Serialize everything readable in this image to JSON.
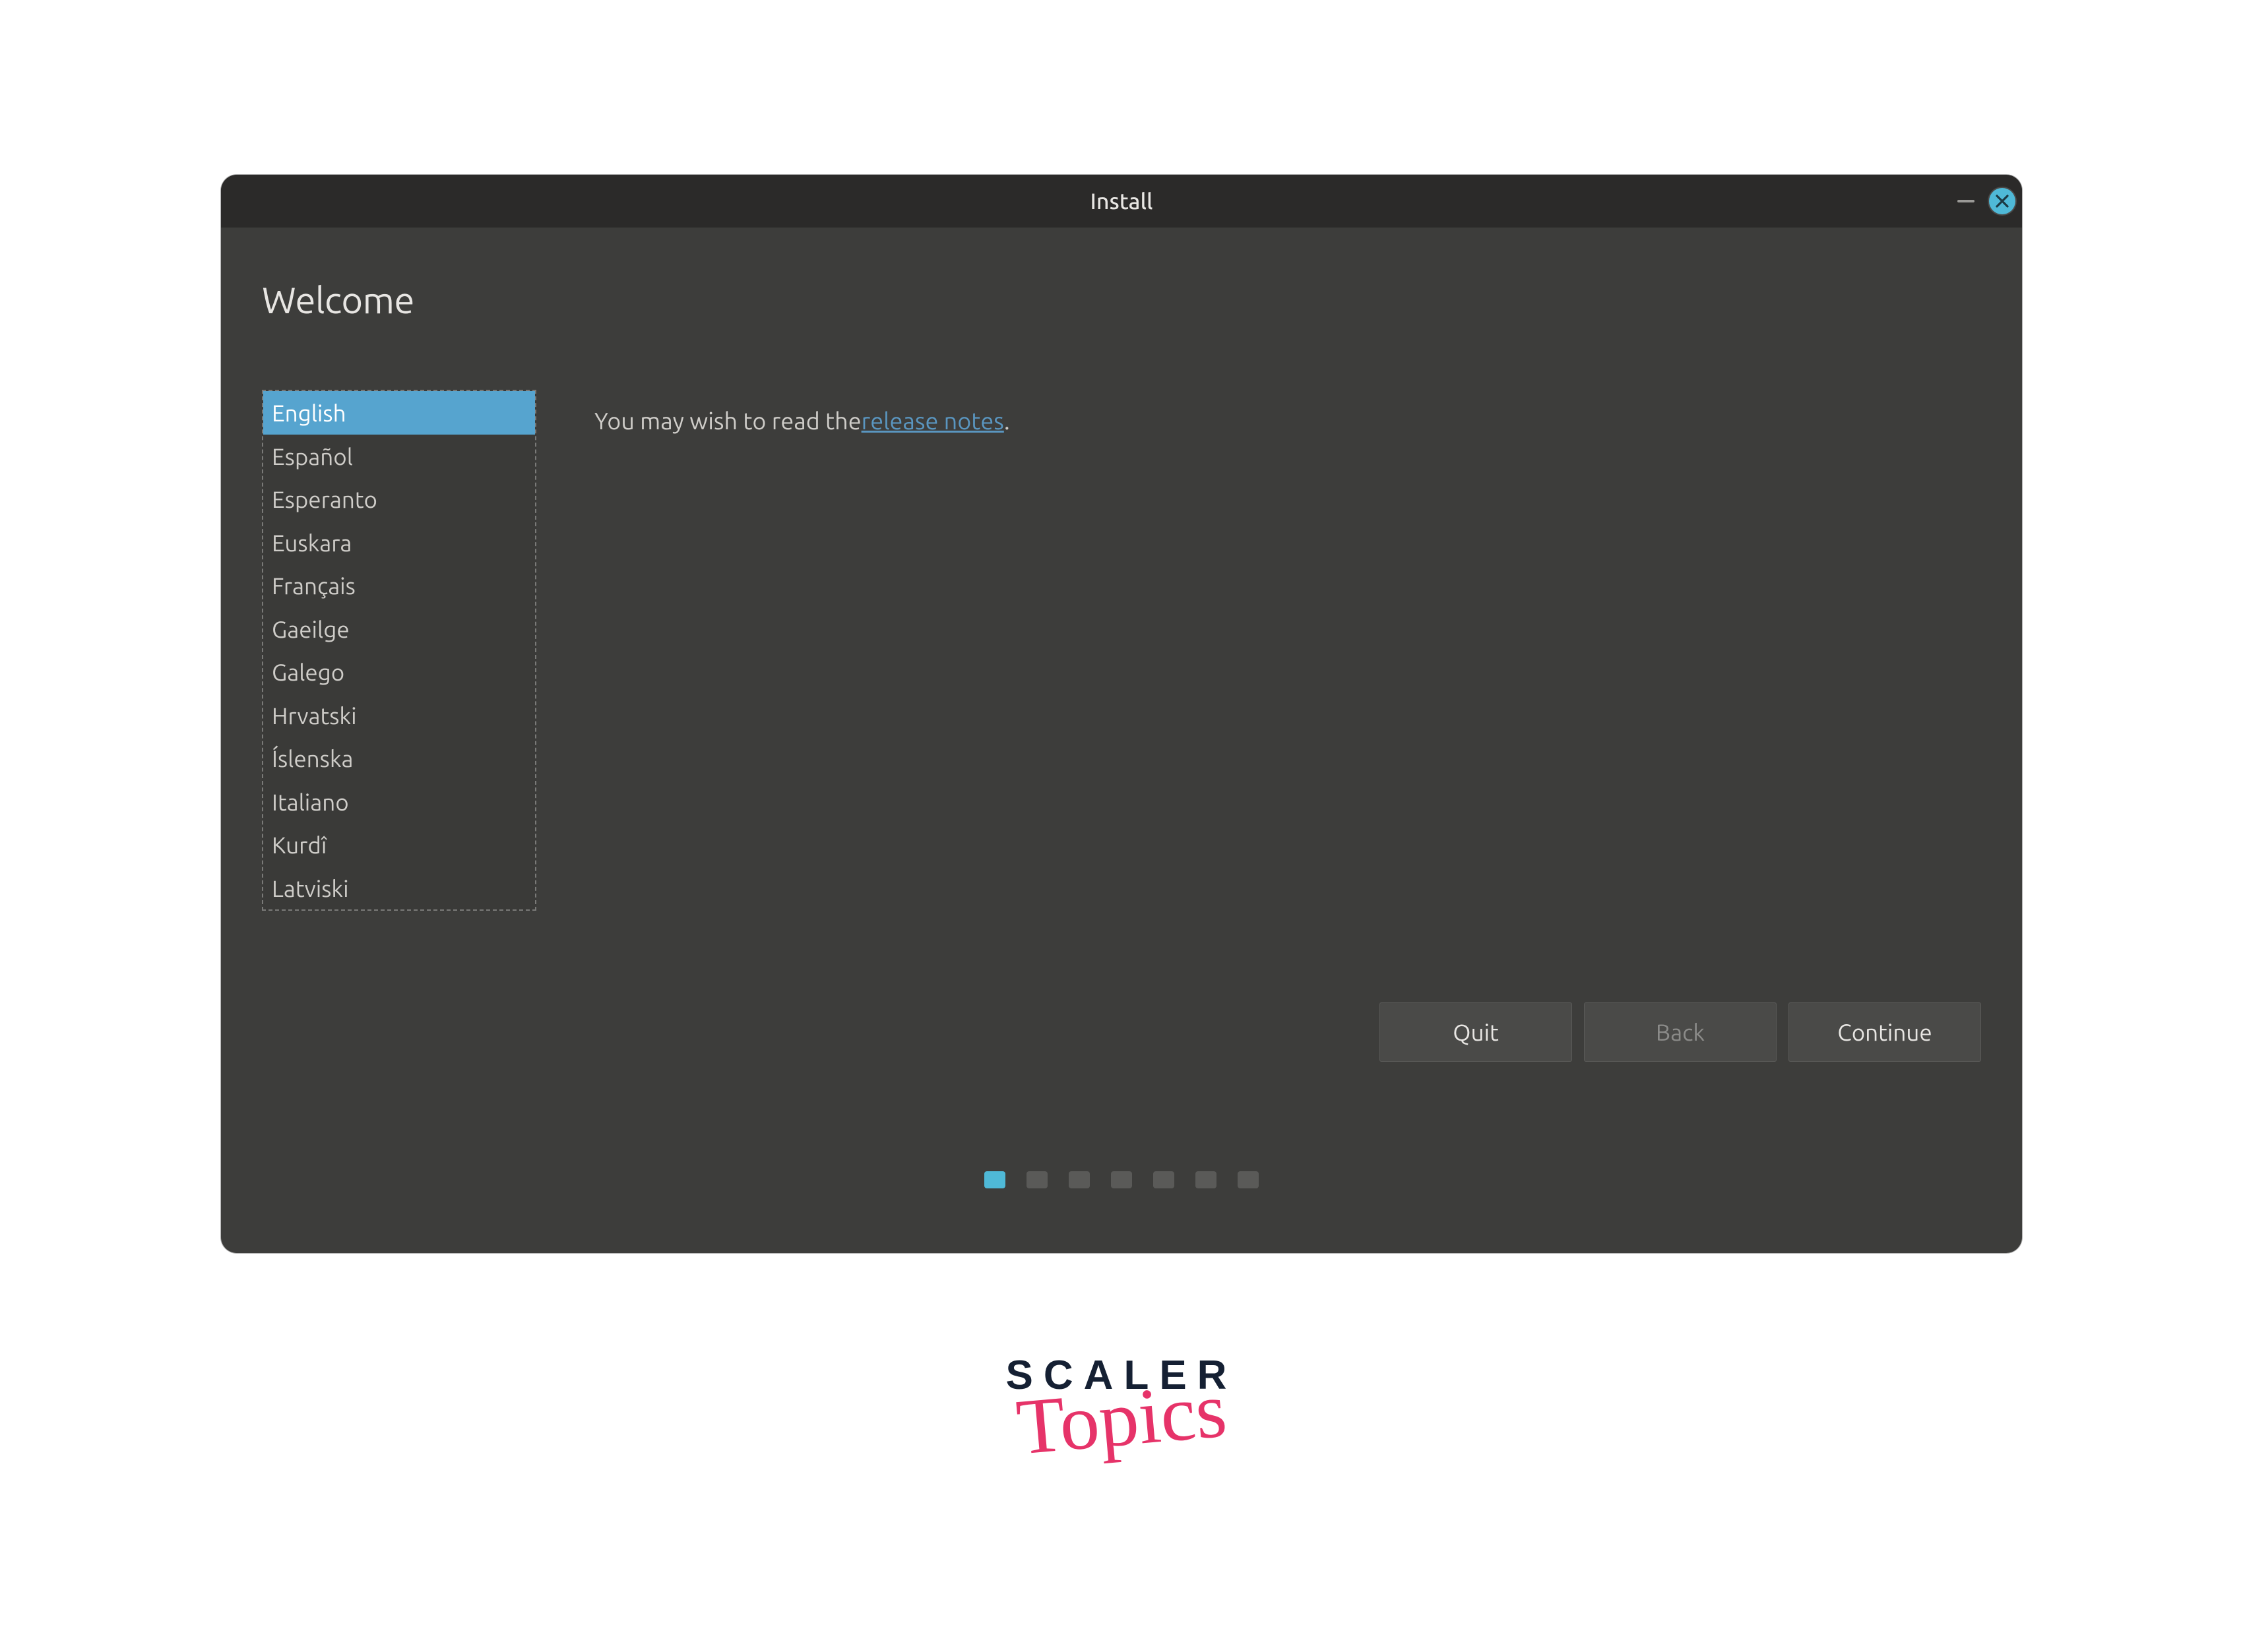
{
  "window": {
    "title": "Install",
    "heading": "Welcome"
  },
  "release": {
    "prefix": "You may wish to read the ",
    "link": "release notes",
    "suffix": "."
  },
  "languages": {
    "selected_index": 0,
    "items": [
      "English",
      "Español",
      "Esperanto",
      "Euskara",
      "Français",
      "Gaeilge",
      "Galego",
      "Hrvatski",
      "Íslenska",
      "Italiano",
      "Kurdî",
      "Latviski"
    ]
  },
  "buttons": {
    "quit": "Quit",
    "back": "Back",
    "continue": "Continue"
  },
  "progress": {
    "total_steps": 7,
    "current_step": 1
  },
  "branding": {
    "line1": "SCALER",
    "line2": "Topics"
  },
  "colors": {
    "window_body": "#3d3d3b",
    "titlebar": "#2b2a29",
    "accent": "#4fb9d7",
    "selected_row": "#56a4cf",
    "link": "#5a96c0",
    "brand_primary": "#152033",
    "brand_accent": "#e63369"
  }
}
